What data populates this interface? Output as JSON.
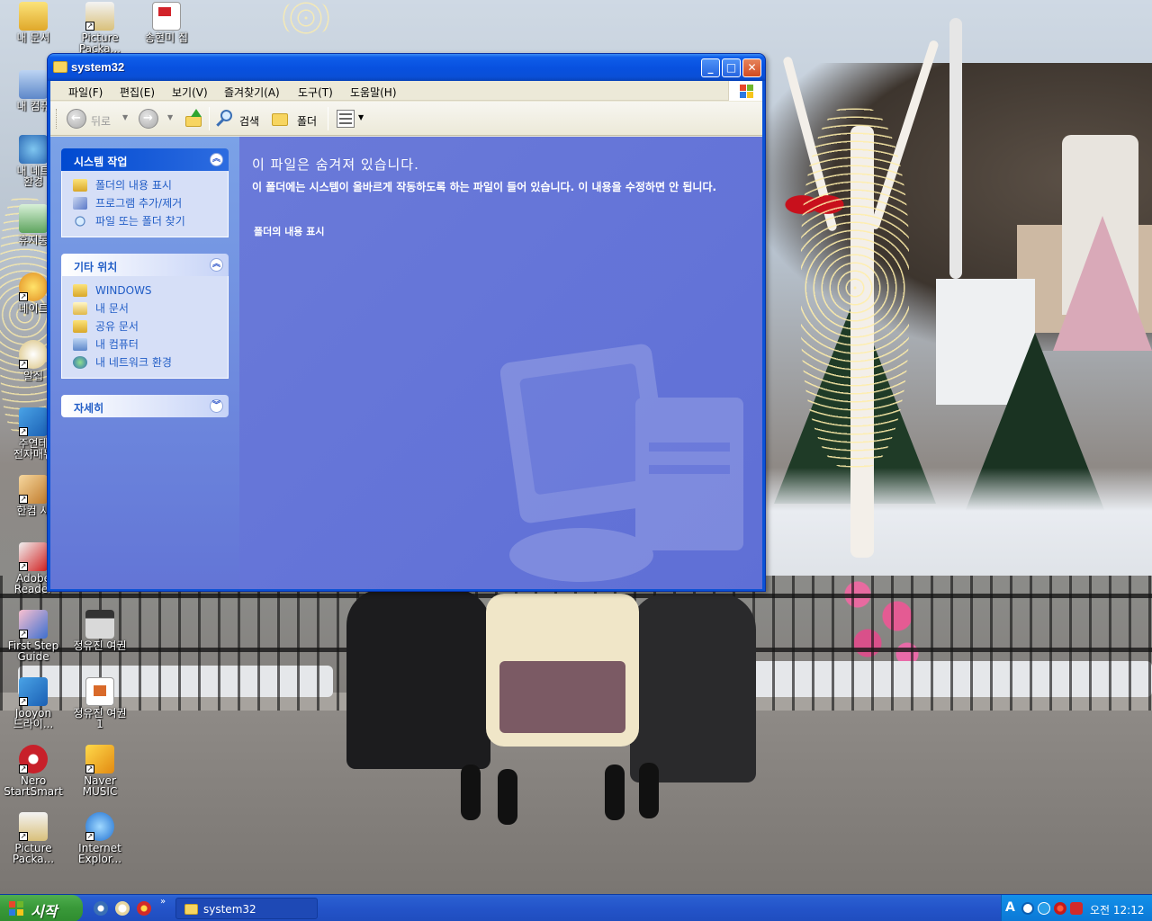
{
  "desktop": {
    "icons": [
      {
        "label": "내 문서"
      },
      {
        "label": "Picture\nPacka..."
      },
      {
        "label": "송현미 집"
      },
      {
        "label": "내 컴퓨"
      },
      {
        "label": "내 네트\n환경"
      },
      {
        "label": "휴지통"
      },
      {
        "label": "네이트"
      },
      {
        "label": "알집"
      },
      {
        "label": "주연테\n전자매뉴"
      },
      {
        "label": "한컴 사"
      },
      {
        "label": "Adobe\nReader"
      },
      {
        "label": "First Step\nGuide"
      },
      {
        "label": "정유진 여권"
      },
      {
        "label": "Jooyon\n드라이..."
      },
      {
        "label": "정유진 여권\n1"
      },
      {
        "label": "Nero\nStartSmart"
      },
      {
        "label": "Naver\nMUSIC"
      },
      {
        "label": "Picture\nPacka..."
      },
      {
        "label": "Internet\nExplor..."
      }
    ]
  },
  "window": {
    "title": "system32",
    "controls": {
      "minimize": "_",
      "maximize": "□",
      "close": "✕"
    },
    "menu": [
      "파일(F)",
      "편집(E)",
      "보기(V)",
      "즐겨찾기(A)",
      "도구(T)",
      "도움말(H)"
    ],
    "toolbar": {
      "back": "뒤로",
      "search": "검색",
      "folders": "폴더"
    },
    "taskpane": {
      "system_tasks": {
        "title": "시스템 작업",
        "items": [
          "폴더의 내용 표시",
          "프로그램 추가/제거",
          "파일 또는 폴더 찾기"
        ]
      },
      "other_places": {
        "title": "기타 위치",
        "items": [
          "WINDOWS",
          "내 문서",
          "공유 문서",
          "내 컴퓨터",
          "내 네트워크 환경"
        ]
      },
      "details": {
        "title": "자세히"
      }
    },
    "main": {
      "heading": "이 파일은 숨겨져 있습니다.",
      "description": "이 폴더에는 시스템이 올바르게 작동하도록 하는 파일이 들어 있습니다. 이 내용을 수정하면 안 됩니다.",
      "show_link": "폴더의 내용 표시"
    }
  },
  "taskbar": {
    "start": "시작",
    "quick_more": "»",
    "task": "system32",
    "tray": {
      "ime": "A",
      "clock": "오전 12:12"
    }
  },
  "colors": {
    "titlebar": "#0851e0",
    "taskpane_header_special": "#0049d0",
    "main_bg": "#6a7ad9",
    "start_green": "#3a9a3a",
    "taskbar_blue": "#2454c9"
  }
}
